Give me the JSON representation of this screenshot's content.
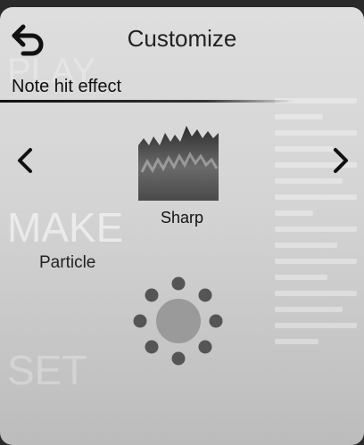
{
  "header": {
    "title": "Customize",
    "back_icon": "back-arrow-icon"
  },
  "section": {
    "label": "Note hit effect"
  },
  "selector": {
    "prev_icon": "chevron-left-icon",
    "next_icon": "chevron-right-icon",
    "current_effect": "Sharp",
    "preview_icon": "sharp-effect-icon"
  },
  "particle": {
    "label": "Particle",
    "icon": "particle-ring-icon"
  },
  "colors": {
    "panel": "#d8d8d8",
    "text": "#111111",
    "particle_dots": "#555555",
    "particle_core": "#9a9a9a"
  }
}
